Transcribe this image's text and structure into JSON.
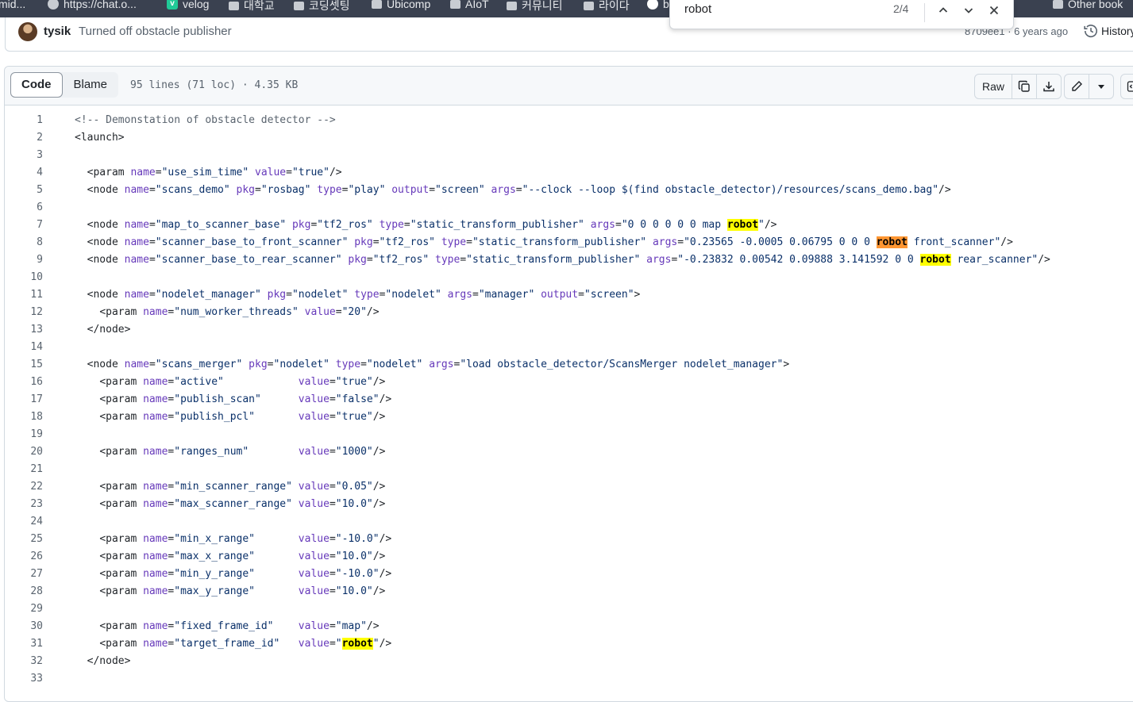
{
  "bookmarks": [
    {
      "label": "mid..."
    },
    {
      "label": "https://chat.o..."
    },
    {
      "label": "velog"
    },
    {
      "label": "대학교"
    },
    {
      "label": "코딩셋팅"
    },
    {
      "label": "Ubicomp"
    },
    {
      "label": "AIoT"
    },
    {
      "label": "커뮤니티"
    },
    {
      "label": "라이다"
    },
    {
      "label": "b"
    },
    {
      "label": "Other book"
    }
  ],
  "find": {
    "query": "robot",
    "count": "2/4"
  },
  "commit": {
    "author": "tysik",
    "message": "Turned off obstacle publisher",
    "sha_time": "8709ee1 · 6 years ago",
    "history_label": "History"
  },
  "file": {
    "tabs": [
      "Code",
      "Blame"
    ],
    "info": "95 lines (71 loc) · 4.35 KB",
    "raw_label": "Raw"
  },
  "code_lines": [
    {
      "n": "1",
      "t": "<!-- Demonstation of obstacle detector -->"
    },
    {
      "n": "2",
      "t": "<launch>"
    },
    {
      "n": "3",
      "t": ""
    },
    {
      "n": "4",
      "t": "  <param name=\"use_sim_time\" value=\"true\"/>"
    },
    {
      "n": "5",
      "t": "  <node name=\"scans_demo\" pkg=\"rosbag\" type=\"play\" output=\"screen\" args=\"--clock --loop $(find obstacle_detector)/resources/scans_demo.bag\"/>"
    },
    {
      "n": "6",
      "t": ""
    },
    {
      "n": "7",
      "t": "  <node name=\"map_to_scanner_base\" pkg=\"tf2_ros\" type=\"static_transform_publisher\" args=\"0 0 0 0 0 0 map robot\"/>"
    },
    {
      "n": "8",
      "t": "  <node name=\"scanner_base_to_front_scanner\" pkg=\"tf2_ros\" type=\"static_transform_publisher\" args=\"0.23565 -0.0005 0.06795 0 0 0 robot front_scanner\"/>"
    },
    {
      "n": "9",
      "t": "  <node name=\"scanner_base_to_rear_scanner\" pkg=\"tf2_ros\" type=\"static_transform_publisher\" args=\"-0.23832 0.00542 0.09888 3.141592 0 0 robot rear_scanner\"/>"
    },
    {
      "n": "10",
      "t": ""
    },
    {
      "n": "11",
      "t": "  <node name=\"nodelet_manager\" pkg=\"nodelet\" type=\"nodelet\" args=\"manager\" output=\"screen\">"
    },
    {
      "n": "12",
      "t": "    <param name=\"num_worker_threads\" value=\"20\"/>"
    },
    {
      "n": "13",
      "t": "  </node>"
    },
    {
      "n": "14",
      "t": ""
    },
    {
      "n": "15",
      "t": "  <node name=\"scans_merger\" pkg=\"nodelet\" type=\"nodelet\" args=\"load obstacle_detector/ScansMerger nodelet_manager\">"
    },
    {
      "n": "16",
      "t": "    <param name=\"active\"            value=\"true\"/>"
    },
    {
      "n": "17",
      "t": "    <param name=\"publish_scan\"      value=\"false\"/>"
    },
    {
      "n": "18",
      "t": "    <param name=\"publish_pcl\"       value=\"true\"/>"
    },
    {
      "n": "19",
      "t": ""
    },
    {
      "n": "20",
      "t": "    <param name=\"ranges_num\"        value=\"1000\"/>"
    },
    {
      "n": "21",
      "t": ""
    },
    {
      "n": "22",
      "t": "    <param name=\"min_scanner_range\" value=\"0.05\"/>"
    },
    {
      "n": "23",
      "t": "    <param name=\"max_scanner_range\" value=\"10.0\"/>"
    },
    {
      "n": "24",
      "t": ""
    },
    {
      "n": "25",
      "t": "    <param name=\"min_x_range\"       value=\"-10.0\"/>"
    },
    {
      "n": "26",
      "t": "    <param name=\"max_x_range\"       value=\"10.0\"/>"
    },
    {
      "n": "27",
      "t": "    <param name=\"min_y_range\"       value=\"-10.0\"/>"
    },
    {
      "n": "28",
      "t": "    <param name=\"max_y_range\"       value=\"10.0\"/>"
    },
    {
      "n": "29",
      "t": ""
    },
    {
      "n": "30",
      "t": "    <param name=\"fixed_frame_id\"    value=\"map\"/>"
    },
    {
      "n": "31",
      "t": "    <param name=\"target_frame_id\"   value=\"robot\"/>"
    },
    {
      "n": "32",
      "t": "  </node>"
    },
    {
      "n": "33",
      "t": ""
    }
  ],
  "find_match_current": 2
}
